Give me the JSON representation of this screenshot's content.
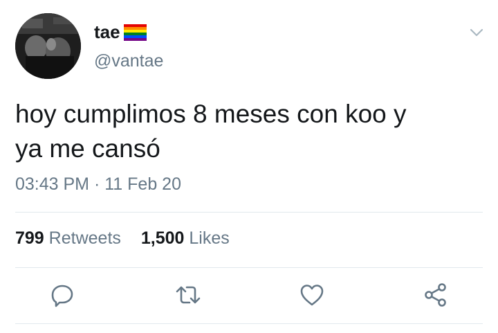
{
  "user": {
    "display_name": "tae",
    "handle": "@vantae"
  },
  "tweet": {
    "text_lines": [
      "hoy cumplimos 8 meses con koo y",
      "ya me cansó"
    ],
    "time": "03:43 PM",
    "separator": "·",
    "date": "11 Feb 20"
  },
  "stats": {
    "retweets_count": "799",
    "retweets_label": "Retweets",
    "likes_count": "1,500",
    "likes_label": "Likes"
  },
  "icons": {
    "caret": "chevron-down-icon",
    "reply": "reply-icon",
    "retweet": "retweet-icon",
    "like": "heart-icon",
    "share": "share-icon",
    "name_emoji": "rainbow-flag-icon"
  },
  "colors": {
    "text": "#14171a",
    "secondary": "#657786",
    "icon": "#657786",
    "divider": "#e1e8ed"
  }
}
